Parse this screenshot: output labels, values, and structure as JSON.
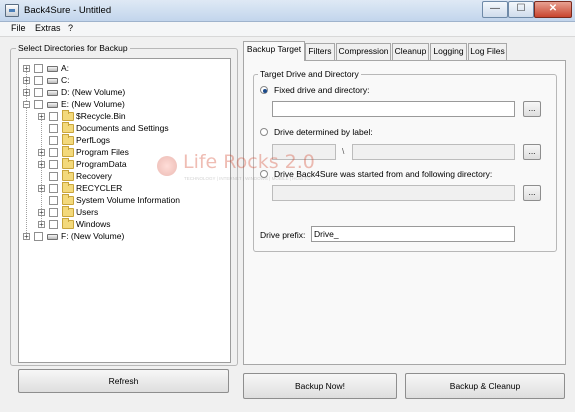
{
  "window": {
    "title": "Back4Sure - Untitled",
    "minimize": "—",
    "maximize": "☐",
    "close": "✕"
  },
  "menu": [
    "File",
    "Extras",
    "?"
  ],
  "left": {
    "group_title": "Select Directories for Backup",
    "tree": [
      {
        "label": "A:",
        "type": "drive",
        "depth": 0,
        "expander": "+"
      },
      {
        "label": "C:",
        "type": "drive",
        "depth": 0,
        "expander": "+"
      },
      {
        "label": "D: (New Volume)",
        "type": "drive",
        "depth": 0,
        "expander": "+"
      },
      {
        "label": "E: (New Volume)",
        "type": "drive",
        "depth": 0,
        "expander": "−"
      },
      {
        "label": "$Recycle.Bin",
        "type": "folder",
        "depth": 1,
        "expander": "+"
      },
      {
        "label": "Documents and Settings",
        "type": "folder",
        "depth": 1,
        "expander": ""
      },
      {
        "label": "PerfLogs",
        "type": "folder",
        "depth": 1,
        "expander": ""
      },
      {
        "label": "Program Files",
        "type": "folder",
        "depth": 1,
        "expander": "+"
      },
      {
        "label": "ProgramData",
        "type": "folder",
        "depth": 1,
        "expander": "+"
      },
      {
        "label": "Recovery",
        "type": "folder",
        "depth": 1,
        "expander": ""
      },
      {
        "label": "RECYCLER",
        "type": "folder",
        "depth": 1,
        "expander": "+"
      },
      {
        "label": "System Volume Information",
        "type": "folder",
        "depth": 1,
        "expander": ""
      },
      {
        "label": "Users",
        "type": "folder",
        "depth": 1,
        "expander": "+"
      },
      {
        "label": "Windows",
        "type": "folder",
        "depth": 1,
        "expander": "+"
      },
      {
        "label": "F: (New Volume)",
        "type": "drive",
        "depth": 0,
        "expander": "+"
      }
    ],
    "refresh_label": "Refresh"
  },
  "tabs": [
    {
      "label": "Backup Target",
      "active": true
    },
    {
      "label": "Filters",
      "active": false
    },
    {
      "label": "Compression",
      "active": false
    },
    {
      "label": "Cleanup",
      "active": false
    },
    {
      "label": "Logging",
      "active": false
    },
    {
      "label": "Log Files",
      "active": false
    }
  ],
  "target": {
    "group_title": "Target Drive and Directory",
    "opt_fixed": "Fixed drive and directory:",
    "opt_label": "Drive determined by label:",
    "opt_started": "Drive Back4Sure was started from and following directory:",
    "browse": "...",
    "separator": "\\",
    "prefix_label": "Drive prefix:",
    "prefix_value": "Drive_"
  },
  "actions": {
    "backup_now": "Backup Now!",
    "backup_cleanup": "Backup & Cleanup"
  },
  "watermark": {
    "text": "Life Rocks 2.0",
    "sub": "TECHNOLOGY | INTERNET | WINDOWS | MOBILE | HOW TO"
  }
}
